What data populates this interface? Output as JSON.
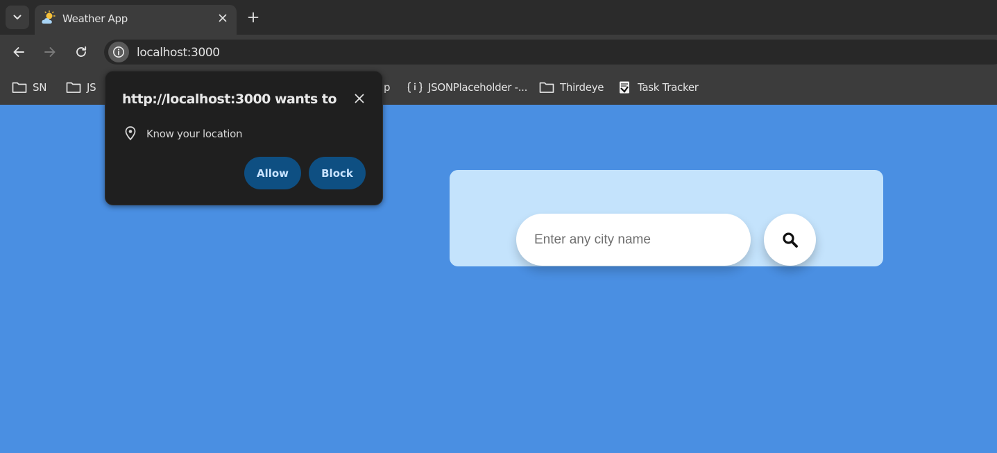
{
  "browser": {
    "tab": {
      "title": "Weather App",
      "favicon": "weather-sun-cloud-icon"
    },
    "address_bar": {
      "url": "localhost:3000"
    },
    "bookmarks": [
      {
        "label": "SN",
        "icon": "folder-icon"
      },
      {
        "label": "JS",
        "icon": "folder-icon"
      },
      {
        "label": "p",
        "icon": ""
      },
      {
        "label": "JSONPlaceholder -...",
        "icon": "jsonplaceholder-icon"
      },
      {
        "label": "Thirdeye",
        "icon": "folder-icon"
      },
      {
        "label": "Task Tracker",
        "icon": "task-tracker-icon"
      }
    ]
  },
  "permission_prompt": {
    "title": "http://localhost:3000 wants to",
    "request": "Know your location",
    "allow_label": "Allow",
    "block_label": "Block"
  },
  "search": {
    "placeholder": "Enter any city name"
  },
  "colors": {
    "page_background": "#4a8fe2",
    "card_background": "#c4e3fc",
    "popup_background": "#1f1f1f",
    "popup_button": "#0e4f82"
  }
}
